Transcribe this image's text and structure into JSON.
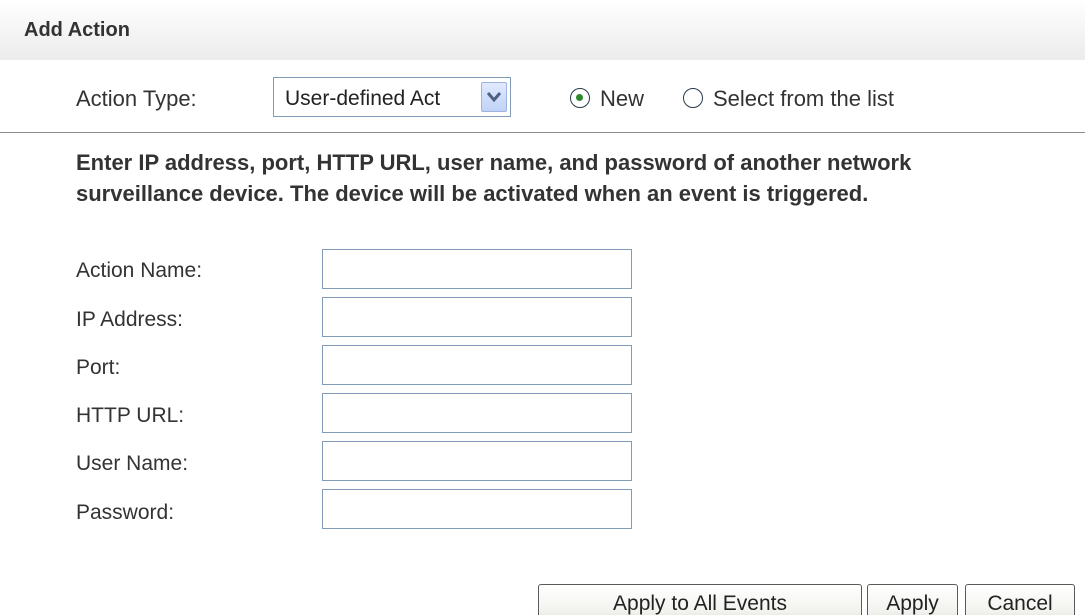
{
  "header": {
    "title": "Add Action"
  },
  "action_type": {
    "label": "Action Type:",
    "selected": "User-defined Act",
    "options": {
      "new": {
        "label": "New",
        "selected": true
      },
      "select_list": {
        "label": "Select from the list",
        "selected": false
      }
    }
  },
  "description": "Enter IP address, port, HTTP URL, user name, and password of another network surveillance device. The device will be activated when an event is triggered.",
  "fields": [
    {
      "label": "Action Name:",
      "value": ""
    },
    {
      "label": "IP Address:",
      "value": ""
    },
    {
      "label": "Port:",
      "value": ""
    },
    {
      "label": "HTTP URL:",
      "value": ""
    },
    {
      "label": "User Name:",
      "value": ""
    },
    {
      "label": "Password:",
      "value": ""
    }
  ],
  "buttons": {
    "apply_all": "Apply to All Events",
    "apply": "Apply",
    "cancel": "Cancel"
  },
  "colors": {
    "input_border": "#7f9db9",
    "radio_dot": "#2b8a2b",
    "divider": "#8c8c8c"
  },
  "icons": {
    "dropdown": "chevron-down-icon"
  }
}
